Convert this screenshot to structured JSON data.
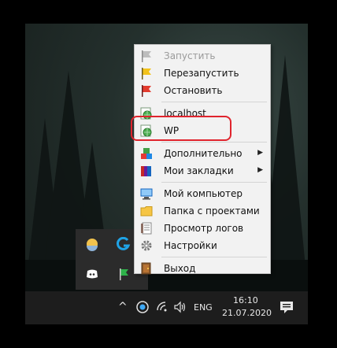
{
  "menu": {
    "items": [
      {
        "label": "Запустить",
        "icon": "gray-flag-icon",
        "enabled": false
      },
      {
        "label": "Перезапустить",
        "icon": "yellow-flag-icon",
        "enabled": true
      },
      {
        "label": "Остановить",
        "icon": "red-flag-icon",
        "enabled": true
      },
      {
        "label": "localhost",
        "icon": "globe-page-icon",
        "enabled": true
      },
      {
        "label": "WP",
        "icon": "globe-page-icon",
        "enabled": true
      },
      {
        "label": "Дополнительно",
        "icon": "colored-blocks-icon",
        "submenu": true
      },
      {
        "label": "Мои закладки",
        "icon": "books-icon",
        "submenu": true
      },
      {
        "label": "Мой компьютер",
        "icon": "computer-icon"
      },
      {
        "label": "Папка с проектами",
        "icon": "folder-icon"
      },
      {
        "label": "Просмотр логов",
        "icon": "log-page-icon"
      },
      {
        "label": "Настройки",
        "icon": "gear-icon"
      },
      {
        "label": "Выход",
        "icon": "exit-door-icon"
      }
    ],
    "submenu_arrow": "▶"
  },
  "taskbar": {
    "chevron": "^",
    "language": "ENG",
    "time": "16:10",
    "date": "21.07.2020"
  },
  "colors": {
    "highlight_border": "#e0242d",
    "menu_background": "#f2f2f2",
    "taskbar": "#1d1d1d"
  }
}
